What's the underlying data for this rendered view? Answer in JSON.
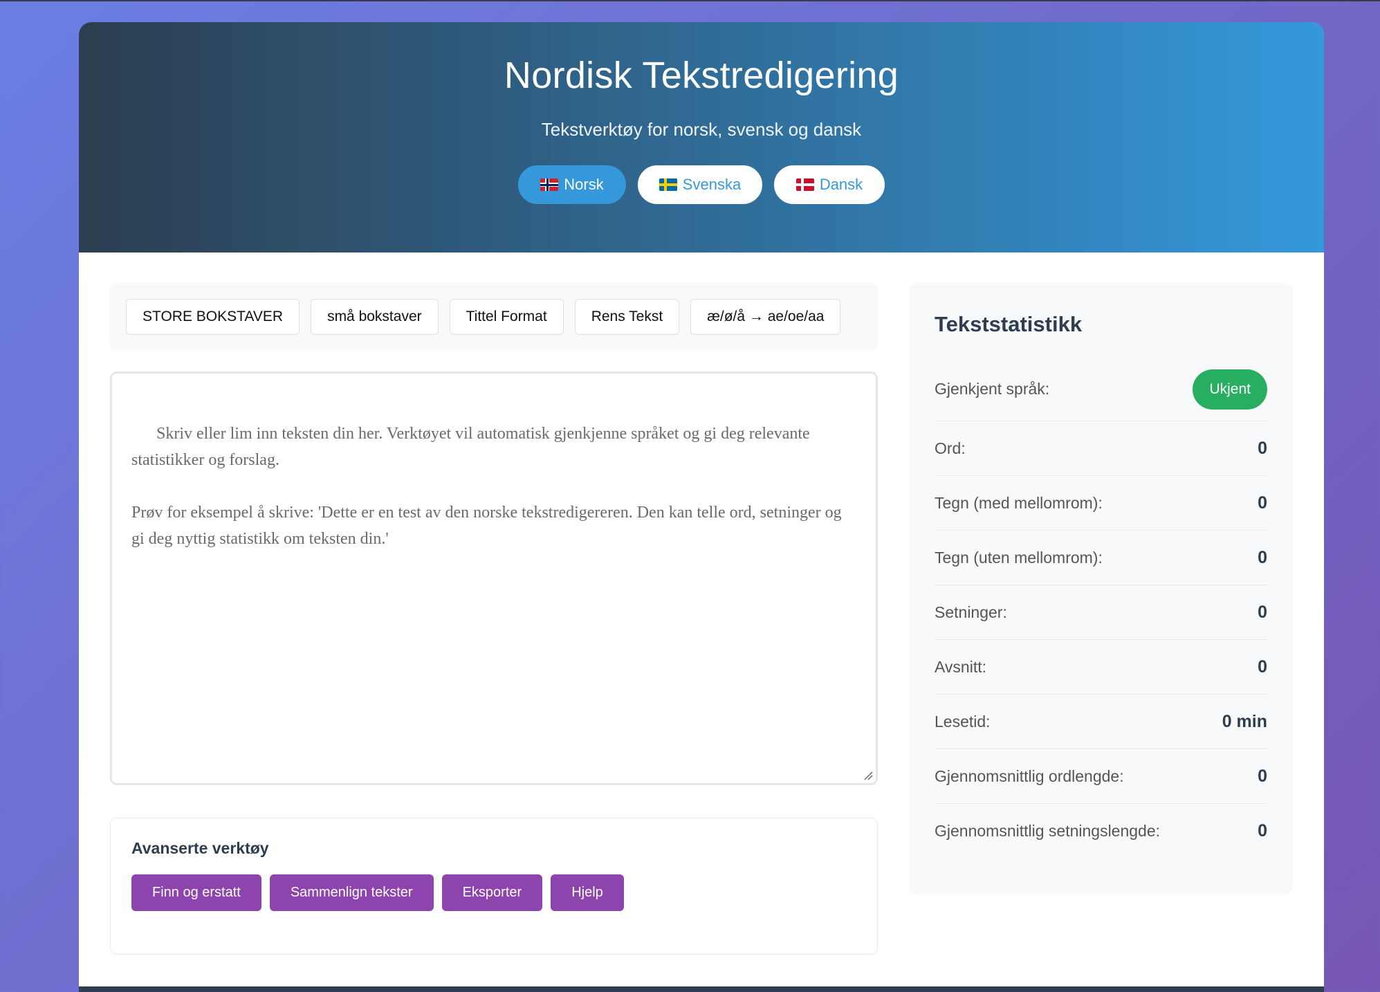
{
  "header": {
    "title": "Nordisk Tekstredigering",
    "subtitle": "Tekstverktøy for norsk, svensk og dansk",
    "languages": [
      {
        "label": "Norsk",
        "flag": "norway-flag-icon",
        "active": true
      },
      {
        "label": "Svenska",
        "flag": "sweden-flag-icon",
        "active": false
      },
      {
        "label": "Dansk",
        "flag": "denmark-flag-icon",
        "active": false
      }
    ]
  },
  "toolbar": {
    "buttons": [
      "STORE BOKSTAVER",
      "små bokstaver",
      "Tittel Format",
      "Rens Tekst",
      "æ/ø/å → ae/oe/aa"
    ]
  },
  "editor": {
    "placeholder": "Skriv eller lim inn teksten din her. Verktøyet vil automatisk gjenkjenne språket og gi deg relevante statistikker og forslag.\n\nPrøv for eksempel å skrive: 'Dette er en test av den norske tekstredigereren. Den kan telle ord, setninger og gi deg nyttig statistikk om teksten din.'"
  },
  "advanced": {
    "title": "Avanserte verktøy",
    "buttons": [
      "Finn og erstatt",
      "Sammenlign tekster",
      "Eksporter",
      "Hjelp"
    ]
  },
  "stats": {
    "title": "Tekststatistikk",
    "language_label": "Gjenkjent språk:",
    "language_value": "Ukjent",
    "rows": [
      {
        "label": "Ord:",
        "value": "0"
      },
      {
        "label": "Tegn (med mellomrom):",
        "value": "0"
      },
      {
        "label": "Tegn (uten mellomrom):",
        "value": "0"
      },
      {
        "label": "Setninger:",
        "value": "0"
      },
      {
        "label": "Avsnitt:",
        "value": "0"
      },
      {
        "label": "Lesetid:",
        "value": "0 min"
      },
      {
        "label": "Gjennomsnittlig ordlengde:",
        "value": "0"
      },
      {
        "label": "Gjennomsnittlig setningslengde:",
        "value": "0"
      }
    ]
  },
  "colors": {
    "accent": "#3498db",
    "header_dark": "#2c3e50",
    "advanced_button": "#8e44ad",
    "language_badge": "#27ae60"
  }
}
